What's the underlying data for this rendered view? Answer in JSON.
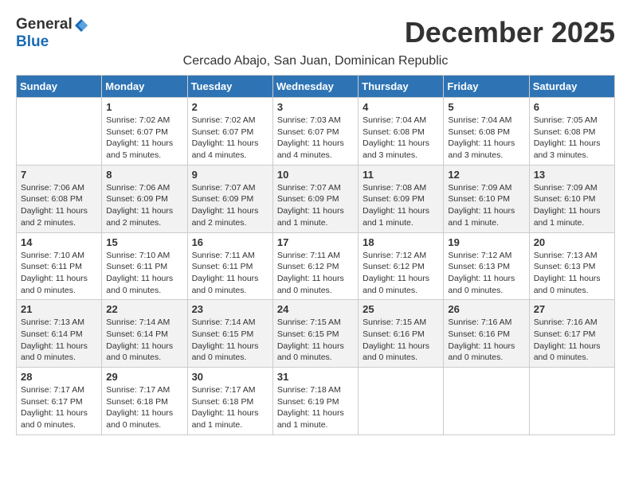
{
  "logo": {
    "general": "General",
    "blue": "Blue"
  },
  "title": "December 2025",
  "subtitle": "Cercado Abajo, San Juan, Dominican Republic",
  "weekdays": [
    "Sunday",
    "Monday",
    "Tuesday",
    "Wednesday",
    "Thursday",
    "Friday",
    "Saturday"
  ],
  "weeks": [
    [
      {
        "day": "",
        "info": ""
      },
      {
        "day": "1",
        "info": "Sunrise: 7:02 AM\nSunset: 6:07 PM\nDaylight: 11 hours\nand 5 minutes."
      },
      {
        "day": "2",
        "info": "Sunrise: 7:02 AM\nSunset: 6:07 PM\nDaylight: 11 hours\nand 4 minutes."
      },
      {
        "day": "3",
        "info": "Sunrise: 7:03 AM\nSunset: 6:07 PM\nDaylight: 11 hours\nand 4 minutes."
      },
      {
        "day": "4",
        "info": "Sunrise: 7:04 AM\nSunset: 6:08 PM\nDaylight: 11 hours\nand 3 minutes."
      },
      {
        "day": "5",
        "info": "Sunrise: 7:04 AM\nSunset: 6:08 PM\nDaylight: 11 hours\nand 3 minutes."
      },
      {
        "day": "6",
        "info": "Sunrise: 7:05 AM\nSunset: 6:08 PM\nDaylight: 11 hours\nand 3 minutes."
      }
    ],
    [
      {
        "day": "7",
        "info": "Sunrise: 7:06 AM\nSunset: 6:08 PM\nDaylight: 11 hours\nand 2 minutes."
      },
      {
        "day": "8",
        "info": "Sunrise: 7:06 AM\nSunset: 6:09 PM\nDaylight: 11 hours\nand 2 minutes."
      },
      {
        "day": "9",
        "info": "Sunrise: 7:07 AM\nSunset: 6:09 PM\nDaylight: 11 hours\nand 2 minutes."
      },
      {
        "day": "10",
        "info": "Sunrise: 7:07 AM\nSunset: 6:09 PM\nDaylight: 11 hours\nand 1 minute."
      },
      {
        "day": "11",
        "info": "Sunrise: 7:08 AM\nSunset: 6:09 PM\nDaylight: 11 hours\nand 1 minute."
      },
      {
        "day": "12",
        "info": "Sunrise: 7:09 AM\nSunset: 6:10 PM\nDaylight: 11 hours\nand 1 minute."
      },
      {
        "day": "13",
        "info": "Sunrise: 7:09 AM\nSunset: 6:10 PM\nDaylight: 11 hours\nand 1 minute."
      }
    ],
    [
      {
        "day": "14",
        "info": "Sunrise: 7:10 AM\nSunset: 6:11 PM\nDaylight: 11 hours\nand 0 minutes."
      },
      {
        "day": "15",
        "info": "Sunrise: 7:10 AM\nSunset: 6:11 PM\nDaylight: 11 hours\nand 0 minutes."
      },
      {
        "day": "16",
        "info": "Sunrise: 7:11 AM\nSunset: 6:11 PM\nDaylight: 11 hours\nand 0 minutes."
      },
      {
        "day": "17",
        "info": "Sunrise: 7:11 AM\nSunset: 6:12 PM\nDaylight: 11 hours\nand 0 minutes."
      },
      {
        "day": "18",
        "info": "Sunrise: 7:12 AM\nSunset: 6:12 PM\nDaylight: 11 hours\nand 0 minutes."
      },
      {
        "day": "19",
        "info": "Sunrise: 7:12 AM\nSunset: 6:13 PM\nDaylight: 11 hours\nand 0 minutes."
      },
      {
        "day": "20",
        "info": "Sunrise: 7:13 AM\nSunset: 6:13 PM\nDaylight: 11 hours\nand 0 minutes."
      }
    ],
    [
      {
        "day": "21",
        "info": "Sunrise: 7:13 AM\nSunset: 6:14 PM\nDaylight: 11 hours\nand 0 minutes."
      },
      {
        "day": "22",
        "info": "Sunrise: 7:14 AM\nSunset: 6:14 PM\nDaylight: 11 hours\nand 0 minutes."
      },
      {
        "day": "23",
        "info": "Sunrise: 7:14 AM\nSunset: 6:15 PM\nDaylight: 11 hours\nand 0 minutes."
      },
      {
        "day": "24",
        "info": "Sunrise: 7:15 AM\nSunset: 6:15 PM\nDaylight: 11 hours\nand 0 minutes."
      },
      {
        "day": "25",
        "info": "Sunrise: 7:15 AM\nSunset: 6:16 PM\nDaylight: 11 hours\nand 0 minutes."
      },
      {
        "day": "26",
        "info": "Sunrise: 7:16 AM\nSunset: 6:16 PM\nDaylight: 11 hours\nand 0 minutes."
      },
      {
        "day": "27",
        "info": "Sunrise: 7:16 AM\nSunset: 6:17 PM\nDaylight: 11 hours\nand 0 minutes."
      }
    ],
    [
      {
        "day": "28",
        "info": "Sunrise: 7:17 AM\nSunset: 6:17 PM\nDaylight: 11 hours\nand 0 minutes."
      },
      {
        "day": "29",
        "info": "Sunrise: 7:17 AM\nSunset: 6:18 PM\nDaylight: 11 hours\nand 0 minutes."
      },
      {
        "day": "30",
        "info": "Sunrise: 7:17 AM\nSunset: 6:18 PM\nDaylight: 11 hours\nand 1 minute."
      },
      {
        "day": "31",
        "info": "Sunrise: 7:18 AM\nSunset: 6:19 PM\nDaylight: 11 hours\nand 1 minute."
      },
      {
        "day": "",
        "info": ""
      },
      {
        "day": "",
        "info": ""
      },
      {
        "day": "",
        "info": ""
      }
    ]
  ]
}
